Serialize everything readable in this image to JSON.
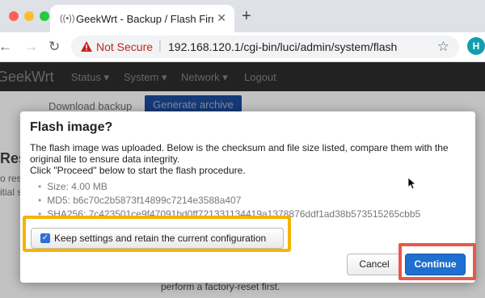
{
  "browser": {
    "tab_title": "GeekWrt - Backup / Flash Firm",
    "security_label": "Not Secure",
    "url": "192.168.120.1/cgi-bin/luci/admin/system/flash",
    "profile_initial": "H"
  },
  "luci": {
    "brand": "GeekWrt",
    "menu": [
      "Status",
      "System",
      "Network",
      "Logout"
    ],
    "bg_download_label": "Download backup",
    "bg_generate_button": "Generate archive",
    "bg_heading": "Rest",
    "bg_side_text_1": "o rest",
    "bg_side_text_2": "itial s",
    "bg_footer": "perform a factory-reset first."
  },
  "modal": {
    "title": "Flash image?",
    "text_line1": "The flash image was uploaded. Below is the checksum and file size listed, compare them with the",
    "text_line2": "original file to ensure data integrity.",
    "text_line3": "Click \"Proceed\" below to start the flash procedure.",
    "size": "Size: 4.00 MB",
    "md5": "MD5: b6c70c2b5873f14899c7214e3588a407",
    "sha256": "SHA256: 7c423501ce9f47091bd0ff721331134419a1378876ddf1ad38b573515265cbb5",
    "keep_settings_label": "Keep settings and retain the current configuration",
    "keep_settings_checked": true,
    "cancel_label": "Cancel",
    "continue_label": "Continue"
  },
  "highlight_colors": {
    "keep_settings": "#f4b400",
    "continue": "#e8584a"
  },
  "icons": [
    "window-close-icon",
    "window-minimize-icon",
    "window-maximize-icon",
    "favicon-icon",
    "tab-close-icon",
    "new-tab-icon",
    "back-icon",
    "forward-icon",
    "reload-icon",
    "warning-icon",
    "bookmark-star-icon",
    "mouse-cursor-icon"
  ]
}
